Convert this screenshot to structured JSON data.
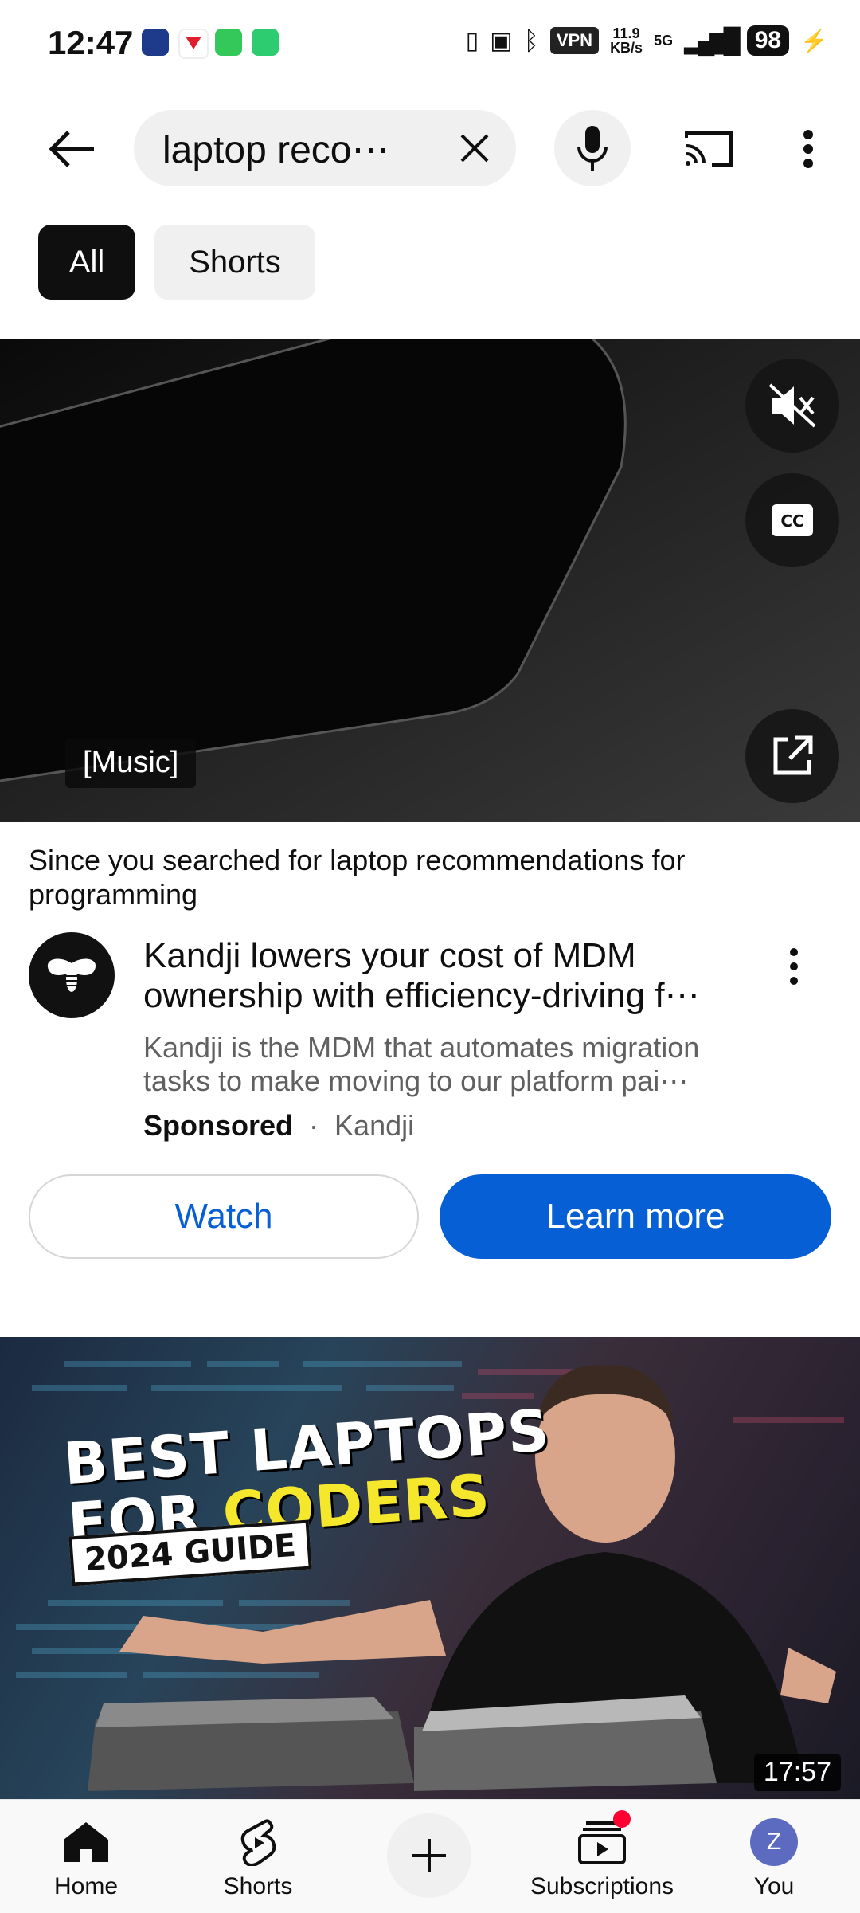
{
  "status_bar": {
    "time": "12:47",
    "vpn": "VPN",
    "net_speed_value": "11.9",
    "net_speed_unit": "KB/s",
    "network": "5G",
    "battery": "98"
  },
  "top_bar": {
    "search_query": "laptop reco⋯"
  },
  "chips": {
    "all": "All",
    "shorts": "Shorts"
  },
  "ad": {
    "caption": "[Music]",
    "because_prefix": "Since you searched for ",
    "because_query": "laptop recommendations for programming",
    "title": "Kandji lowers your cost of MDM ownership with efficiency-driving f⋯",
    "description": "Kandji is the MDM that automates migration tasks to make moving to our platform pai⋯",
    "sponsored": "Sponsored",
    "separator": "·",
    "advertiser": "Kandji",
    "watch_label": "Watch",
    "learn_label": "Learn more"
  },
  "video": {
    "thumb_line1": "BEST LAPTOPS",
    "thumb_line2_a": "FOR ",
    "thumb_line2_b": "CODERS",
    "thumb_line3": "2024 GUIDE",
    "duration": "17:57"
  },
  "bottom_nav": {
    "home": "Home",
    "shorts": "Shorts",
    "subscriptions": "Subscriptions",
    "you": "You",
    "you_initial": "Z"
  },
  "colors": {
    "accent": "#065fd4",
    "chip_selected": "#0f0f0f",
    "notification_dot": "#ff0033"
  }
}
